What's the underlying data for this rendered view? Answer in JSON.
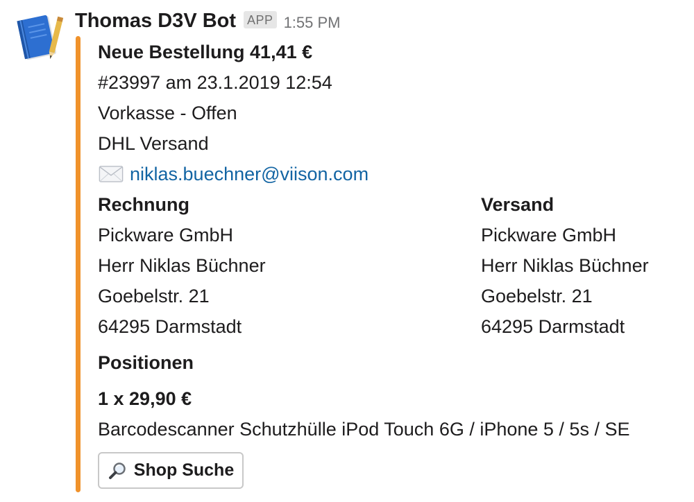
{
  "message": {
    "sender": "Thomas D3V Bot",
    "badge": "APP",
    "timestamp": "1:55 PM",
    "accent_color": "#f0922b"
  },
  "order": {
    "title": "Neue Bestellung 41,41 €",
    "number_line": "#23997 am 23.1.2019 12:54",
    "payment": "Vorkasse - Offen",
    "shipping": "DHL Versand",
    "email_icon": "envelope-icon",
    "email": "niklas.buechner@viison.com"
  },
  "billing": {
    "heading": "Rechnung",
    "lines": [
      "Pickware GmbH",
      "Herr Niklas Büchner",
      "Goebelstr. 21",
      "64295 Darmstadt"
    ]
  },
  "shipping_address": {
    "heading": "Versand",
    "lines": [
      "Pickware GmbH",
      "Herr Niklas Büchner",
      "Goebelstr. 21",
      "64295 Darmstadt"
    ]
  },
  "positions": {
    "heading": "Positionen",
    "item_price": "1 x 29,90 €",
    "item_name": "Barcodescanner Schutzhülle iPod Touch 6G / iPhone 5 / 5s / SE"
  },
  "actions": {
    "shop_search_icon": "magnifier-icon",
    "shop_search_label": "Shop Suche"
  }
}
